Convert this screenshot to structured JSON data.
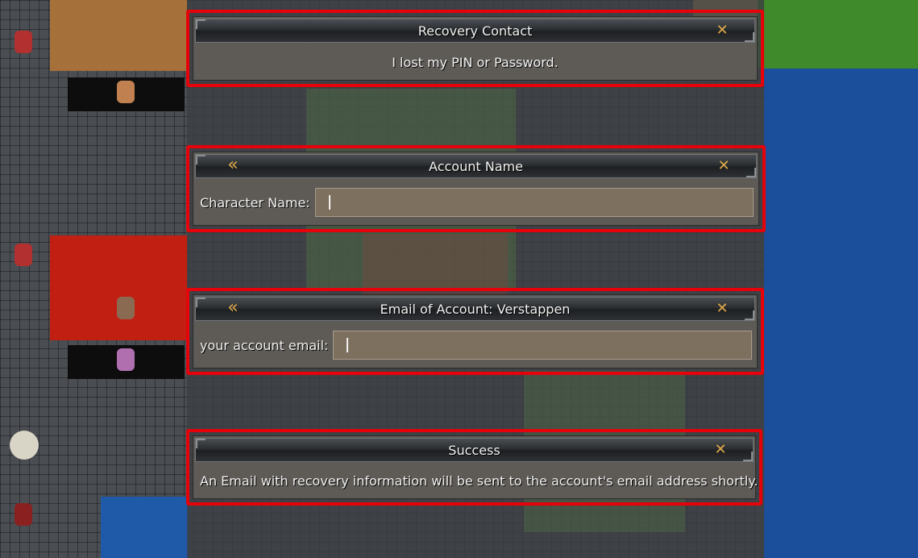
{
  "dialogs": {
    "recovery": {
      "title": "Recovery Contact",
      "option": "I lost my PIN or Password."
    },
    "account": {
      "title": "Account Name",
      "field_label": "Character Name:",
      "field_value": ""
    },
    "email": {
      "title": "Email of Account: Verstappen",
      "field_label": "your account email:",
      "field_value": ""
    },
    "success": {
      "title": "Success",
      "message": "An Email with recovery information will be sent to the account's email address shortly."
    }
  },
  "icons": {
    "close": "close-icon",
    "back": "double-chevron-left-icon"
  },
  "colors": {
    "highlight_border": "#e6020a",
    "accent_icon": "#e0a94a",
    "dialog_body": "#5e5b56",
    "input_bg": "#7e705f"
  }
}
